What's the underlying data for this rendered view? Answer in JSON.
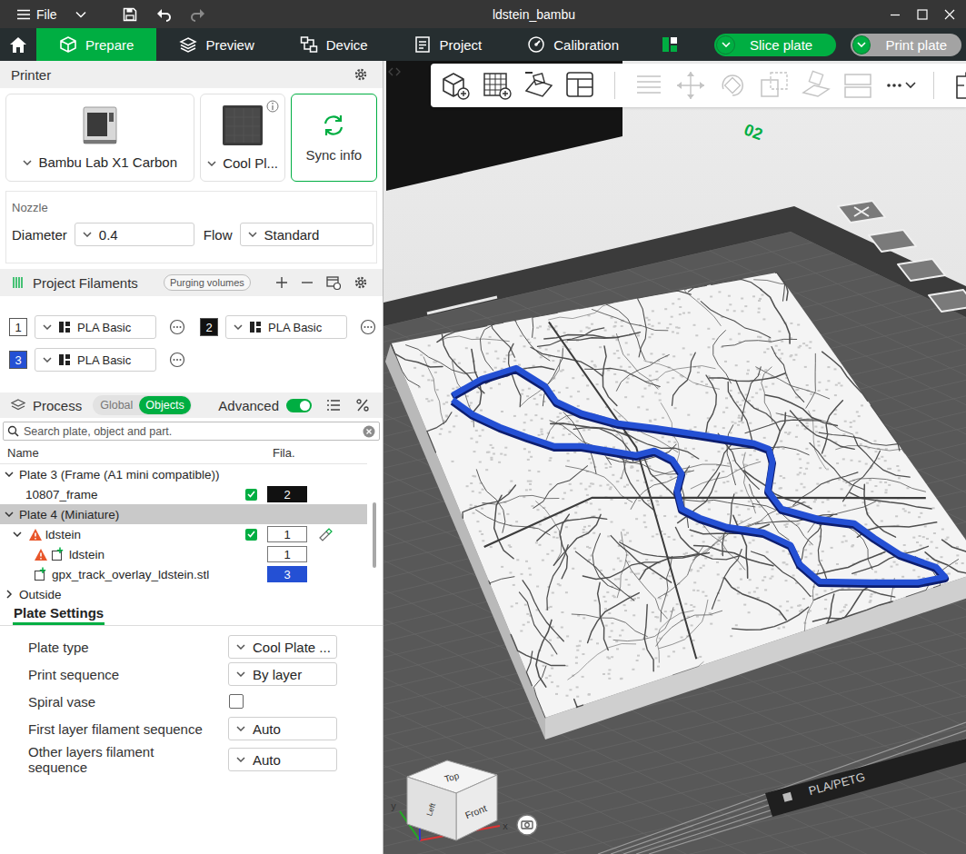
{
  "window": {
    "title": "ldstein_bambu",
    "menu": "File"
  },
  "tabs": [
    {
      "label": "Prepare",
      "selected": true
    },
    {
      "label": "Preview",
      "selected": false
    },
    {
      "label": "Device",
      "selected": false
    },
    {
      "label": "Project",
      "selected": false
    },
    {
      "label": "Calibration",
      "selected": false
    }
  ],
  "actions": [
    {
      "label": "Slice plate",
      "disabled": false
    },
    {
      "label": "Print plate",
      "disabled": true
    }
  ],
  "printer": {
    "title": "Printer",
    "cards": [
      {
        "kind": "printer",
        "label": "Bambu Lab X1 Carbon"
      },
      {
        "kind": "plate",
        "label": "Cool Pl..."
      },
      {
        "kind": "sync",
        "label": "Sync info"
      }
    ]
  },
  "nozzle": {
    "title": "Nozzle",
    "fields": [
      {
        "label": "Diameter",
        "value": "0.4"
      },
      {
        "label": "Flow",
        "value": "Standard"
      }
    ]
  },
  "filaments": {
    "title": "Project Filaments",
    "chip": "Purging volumes",
    "items": [
      {
        "number": "1",
        "name": "PLA Basic",
        "color": "#ffffff"
      },
      {
        "number": "2",
        "name": "PLA Basic",
        "color": "#111111"
      },
      {
        "number": "3",
        "name": "PLA Basic",
        "color": "#2450d4"
      }
    ]
  },
  "process": {
    "title": "Process",
    "modes": [
      {
        "label": "Global",
        "selected": false
      },
      {
        "label": "Objects",
        "selected": true
      }
    ],
    "advanced": {
      "label": "Advanced",
      "on": true
    }
  },
  "search": {
    "placeholder": "Search plate, object and part."
  },
  "objects": {
    "columns": [
      "Name",
      "Fila."
    ],
    "rows": [
      {
        "kind": "plate",
        "name": "Plate 3 (Frame (A1 mini compatible))",
        "expanded": true,
        "selected": false
      },
      {
        "kind": "object",
        "name": "10807_frame",
        "has_children": false,
        "expanded": false,
        "warning": false,
        "checked": true,
        "filament": "2",
        "color": "#111111",
        "painted": false,
        "selected": false
      },
      {
        "kind": "plate",
        "name": "Plate 4 (Miniature)",
        "expanded": true,
        "selected": true
      },
      {
        "kind": "object",
        "name": "ldstein",
        "has_children": true,
        "expanded": true,
        "warning": true,
        "checked": true,
        "filament": "1",
        "color": "#ffffff",
        "painted": true,
        "selected": false
      },
      {
        "kind": "part",
        "name": "ldstein",
        "warning": true,
        "filament": "1",
        "color": "#ffffff",
        "selected": false
      },
      {
        "kind": "part",
        "name": "gpx_track_overlay_ldstein.stl",
        "warning": false,
        "filament": "3",
        "color": "#2450d4",
        "selected": false
      },
      {
        "kind": "plate",
        "name": "Outside",
        "expanded": false,
        "selected": false
      }
    ]
  },
  "plate_settings": {
    "tab": "Plate Settings",
    "rows": [
      {
        "kind": "select",
        "label": "Plate type",
        "value": "Cool Plate ..."
      },
      {
        "kind": "select",
        "label": "Print sequence",
        "value": "By layer"
      },
      {
        "kind": "checkbox",
        "label": "Spiral vase",
        "checked": false
      },
      {
        "kind": "select",
        "label": "First layer filament sequence",
        "value": "Auto"
      },
      {
        "kind": "select",
        "label": "Other layers filament sequence",
        "value": "Auto"
      }
    ]
  },
  "toolbar": [
    {
      "disabled": false
    },
    {
      "disabled": false
    },
    {
      "disabled": false
    },
    {
      "disabled": false
    },
    {
      "disabled": true
    },
    {
      "disabled": true
    },
    {
      "disabled": true
    },
    {
      "disabled": true
    },
    {
      "disabled": true
    },
    {
      "disabled": true
    },
    {
      "disabled": false
    },
    {
      "disabled": false
    }
  ],
  "viewport": {
    "plate_number": "02",
    "plate_label": "PLA/PETG",
    "view_cube": {
      "top": "Top",
      "front": "Front",
      "left": "Left"
    },
    "axes": {
      "x": "x",
      "y": "y"
    }
  }
}
